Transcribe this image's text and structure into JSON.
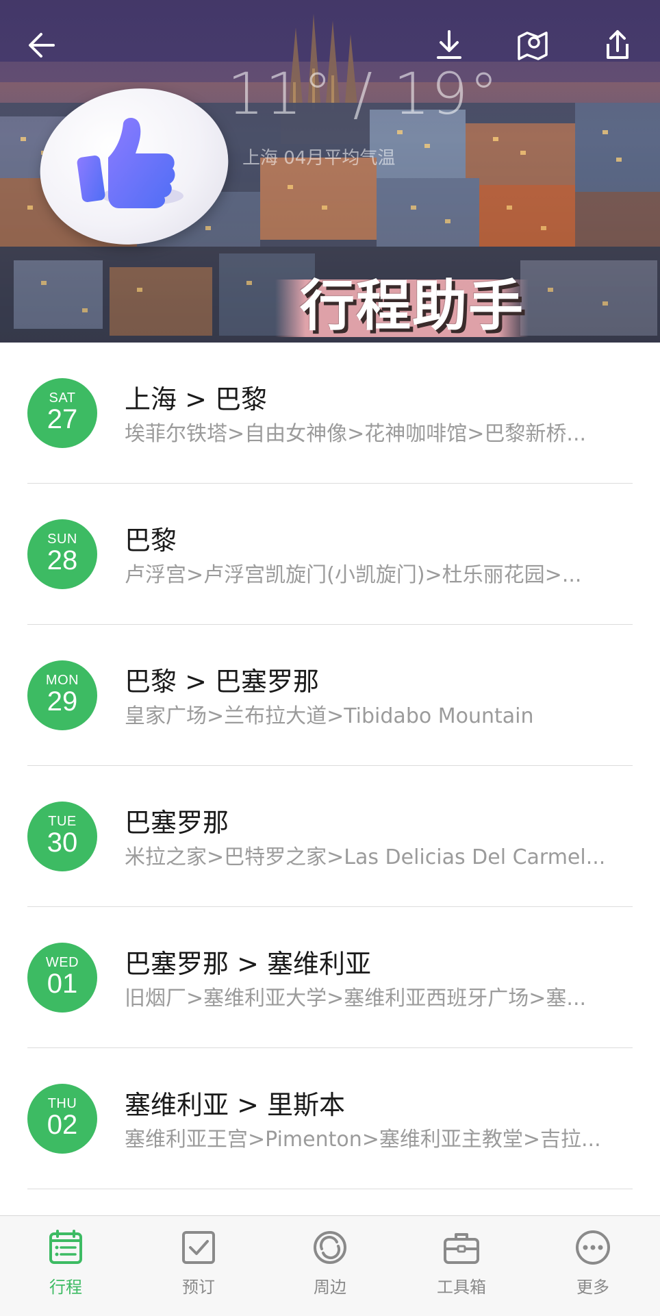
{
  "header": {
    "temperature": "11° / 19°",
    "temperature_note": "上海 04月平均气温",
    "badge_title": "行程助手"
  },
  "itinerary": [
    {
      "dow": "SAT",
      "day": "27",
      "title": "上海 > 巴黎",
      "subtitle": "埃菲尔铁塔>自由女神像>花神咖啡馆>巴黎新桥..."
    },
    {
      "dow": "SUN",
      "day": "28",
      "title": "巴黎",
      "subtitle": "卢浮宫>卢浮宫凯旋门(小凯旋门)>杜乐丽花园>..."
    },
    {
      "dow": "MON",
      "day": "29",
      "title": "巴黎 > 巴塞罗那",
      "subtitle": "皇家广场>兰布拉大道>Tibidabo Mountain"
    },
    {
      "dow": "TUE",
      "day": "30",
      "title": "巴塞罗那",
      "subtitle": "米拉之家>巴特罗之家>Las Delicias Del Carmel..."
    },
    {
      "dow": "WED",
      "day": "01",
      "title": "巴塞罗那 > 塞维利亚",
      "subtitle": "旧烟厂>塞维利亚大学>塞维利亚西班牙广场>塞..."
    },
    {
      "dow": "THU",
      "day": "02",
      "title": "塞维利亚 > 里斯本",
      "subtitle": "塞维利亚王宫>Pimenton>塞维利亚主教堂>吉拉..."
    }
  ],
  "tabbar": {
    "tabs": [
      {
        "label": "行程",
        "icon": "calendar-list-icon",
        "active": true
      },
      {
        "label": "预订",
        "icon": "checkbox-icon",
        "active": false
      },
      {
        "label": "周边",
        "icon": "nearby-icon",
        "active": false
      },
      {
        "label": "工具箱",
        "icon": "toolbox-icon",
        "active": false
      },
      {
        "label": "更多",
        "icon": "more-icon",
        "active": false
      }
    ]
  },
  "colors": {
    "accent_green": "#3dbb63",
    "tab_inactive": "#8a8a8a",
    "subtitle_gray": "#9b9b9b"
  }
}
